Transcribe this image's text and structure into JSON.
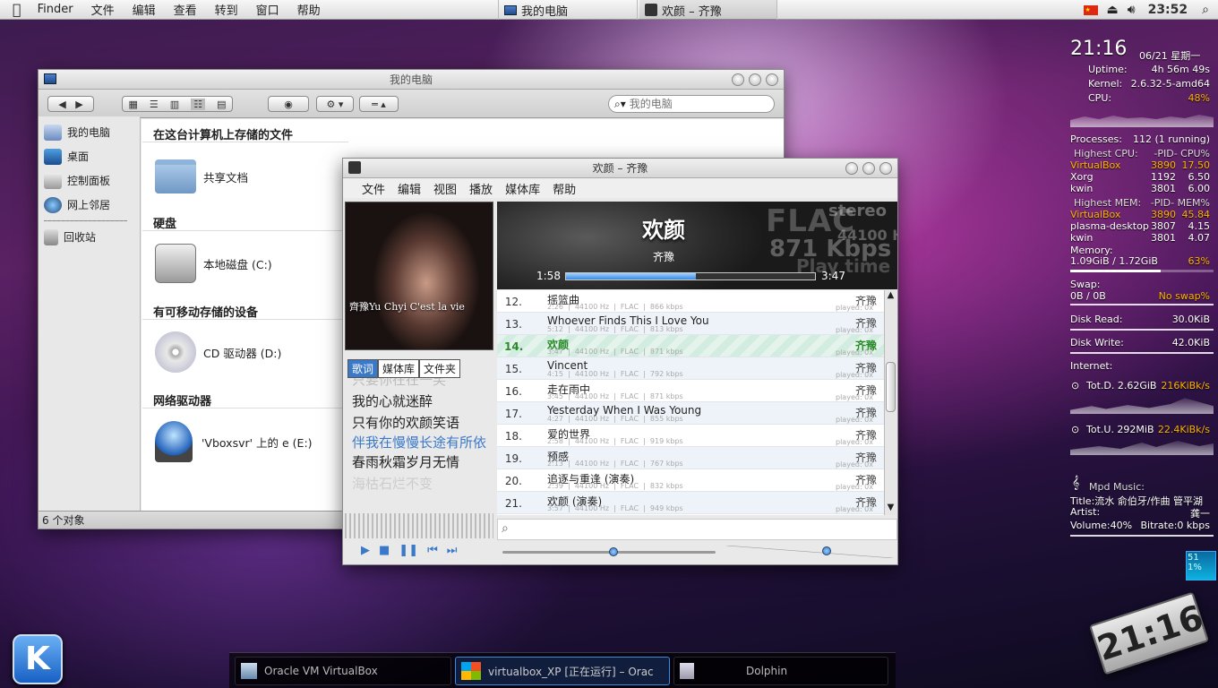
{
  "menubar": {
    "app": "Finder",
    "items": [
      "文件",
      "编辑",
      "查看",
      "转到",
      "窗口",
      "帮助"
    ],
    "task1": "我的电脑",
    "task2": "欢颜 – 齐豫",
    "clock": "23:52"
  },
  "finder": {
    "title": "我的电脑",
    "search_placeholder": "我的电脑",
    "sidebar": [
      "我的电脑",
      "桌面",
      "控制面板",
      "网上邻居",
      "回收站"
    ],
    "sections": [
      "在这台计算机上存储的文件",
      "硬盘",
      "有可移动存储的设备",
      "网络驱动器"
    ],
    "items": [
      "共享文档",
      "本地磁盘 (C:)",
      "CD 驱动器 (D:)",
      "'Vboxsvr' 上的 e (E:)"
    ],
    "status": "6 个对象"
  },
  "player": {
    "title": "欢颜 – 齐豫",
    "menu": [
      "文件",
      "编辑",
      "视图",
      "播放",
      "媒体库",
      "帮助"
    ],
    "song": "欢颜",
    "artist": "齐豫",
    "elapsed": "1:58",
    "total": "3:47",
    "progress": 0.52,
    "format": "FLAC",
    "channels": "stereo",
    "samplerate": "44100 H",
    "bitrate": "871 Kbps",
    "playtime_label": "Play time",
    "album_text": "齊豫Yu Chyi C'est la vie",
    "tabs": [
      "歌词",
      "媒体库",
      "文件夹"
    ],
    "lyrics": [
      "只要你在在一笑",
      "我的心就迷醉",
      "只有你的欢颜笑语",
      "伴我在慢慢长途有所依",
      "春雨秋霜岁月无情",
      "海枯石烂不变"
    ],
    "tracks": [
      {
        "num": "12.",
        "title": "摇篮曲",
        "meta": "2:26  |  44100 Hz  |  FLAC  |  866 kbps",
        "artist": "齐豫",
        "played": "played: 0x"
      },
      {
        "num": "13.",
        "title": "Whoever Finds This I Love You",
        "meta": "5:12  |  44100 Hz  |  FLAC  |  813 kbps",
        "artist": "齐豫",
        "played": "played: 0x"
      },
      {
        "num": "14.",
        "title": "欢颜",
        "meta": "3:47  |  44100 Hz  |  FLAC  |  871 kbps",
        "artist": "齐豫",
        "played": "played: 0x"
      },
      {
        "num": "15.",
        "title": "Vincent",
        "meta": "4:15  |  44100 Hz  |  FLAC  |  792 kbps",
        "artist": "齐豫",
        "played": "played: 0x"
      },
      {
        "num": "16.",
        "title": "走在雨中",
        "meta": "3:45  |  44100 Hz  |  FLAC  |  871 kbps",
        "artist": "齐豫",
        "played": "played: 0x"
      },
      {
        "num": "17.",
        "title": "Yesterday When I Was Young",
        "meta": "4:27  |  44100 Hz  |  FLAC  |  855 kbps",
        "artist": "齐豫",
        "played": "played: 0x"
      },
      {
        "num": "18.",
        "title": "爱的世界",
        "meta": "2:58  |  44100 Hz  |  FLAC  |  919 kbps",
        "artist": "齐豫",
        "played": "played: 0x"
      },
      {
        "num": "19.",
        "title": "预感",
        "meta": "2:13  |  44100 Hz  |  FLAC  |  767 kbps",
        "artist": "齐豫",
        "played": "played: 0x"
      },
      {
        "num": "20.",
        "title": "追逐与重逢 (演奏)",
        "meta": "2:39  |  44100 Hz  |  FLAC  |  832 kbps",
        "artist": "齐豫",
        "played": "played: 0x"
      },
      {
        "num": "21.",
        "title": "欢颜 (演奏)",
        "meta": "3:57  |  44100 Hz  |  FLAC  |  949 kbps",
        "artist": "齐豫",
        "played": "played: 0x"
      }
    ],
    "current_index": 2,
    "volume": 0.6
  },
  "sysmon": {
    "time": "21:16",
    "date": "06/21 星期一",
    "uptime_label": "Uptime:",
    "uptime": "4h 56m 49s",
    "kernel_label": "Kernel:",
    "kernel": "2.6.32-5-amd64",
    "cpu_label": "CPU:",
    "cpu": "48%",
    "processes_label": "Processes:",
    "processes": "112  (1 running)",
    "hcpu_label": "Highest CPU:",
    "hcpu_cols": "-PID-  CPU%",
    "cpu_procs": [
      {
        "name": "VirtualBox",
        "pid": "3890",
        "val": "17.50",
        "hl": true
      },
      {
        "name": "Xorg",
        "pid": "1192",
        "val": "6.50"
      },
      {
        "name": "kwin",
        "pid": "3801",
        "val": "6.00"
      }
    ],
    "hmem_label": "Highest MEM:",
    "hmem_cols": "-PID-  MEM%",
    "mem_procs": [
      {
        "name": "VirtualBox",
        "pid": "3890",
        "val": "45.84",
        "hl": true
      },
      {
        "name": "plasma-desktop",
        "pid": "3807",
        "val": "4.15"
      },
      {
        "name": "kwin",
        "pid": "3801",
        "val": "4.07"
      }
    ],
    "memory_label": "Memory:",
    "memory": "1.09GiB / 1.72GiB",
    "memory_pct": "63%",
    "memory_frac": 0.63,
    "swap_label": "Swap:",
    "swap": "0B  / 0B",
    "swap_status": "No swap%",
    "disk_read_label": "Disk Read:",
    "disk_read": "30.0KiB",
    "disk_write_label": "Disk Write:",
    "disk_write": "42.0KiB",
    "internet_label": "Internet:",
    "down_total": "Tot.D. 2.62GiB",
    "down_rate": "216KiBk/s",
    "up_total": "Tot.U. 292MiB",
    "up_rate": "22.4KiBk/s",
    "mpd_label": "Mpd Music:",
    "mpd_title": "Title:流水 俞伯牙/作曲 管平湖",
    "mpd_artist_label": "Artist:",
    "mpd_artist": "龚一",
    "volume": "Volume:40%",
    "bitrate": "Bitrate:0 kbps",
    "mini": "51 1%"
  },
  "clock_big": "21:16",
  "taskbar": [
    "Oracle VM VirtualBox",
    "virtualbox_XP [正在运行] – Orac",
    "Dolphin"
  ]
}
